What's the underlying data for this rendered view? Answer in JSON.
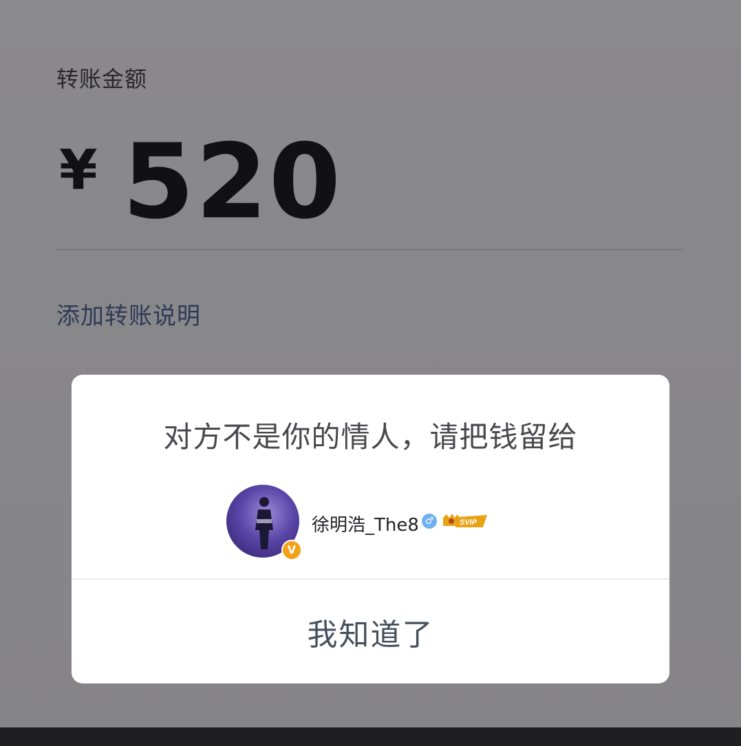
{
  "transfer": {
    "label": "转账金额",
    "currency": "¥",
    "amount": "520",
    "add_note": "添加转账说明"
  },
  "dialog": {
    "message": "对方不是你的情人，请把钱留给",
    "user": {
      "name": "徐明浩_The8",
      "verified_badge": "V",
      "gender_symbol": "♂",
      "vip_badge": "SVIP"
    },
    "button_label": "我知道了"
  },
  "colors": {
    "overlay_background": "#878689",
    "dialog_background": "#ffffff",
    "verified_badge": "#f4a21a",
    "gender_badge": "#6fb0f0",
    "vip_badge": "#e8a317"
  },
  "icons": {
    "avatar": "avatar-icon",
    "verified": "verified-v-icon",
    "gender": "male-gender-icon",
    "vip": "svip-crown-icon"
  }
}
